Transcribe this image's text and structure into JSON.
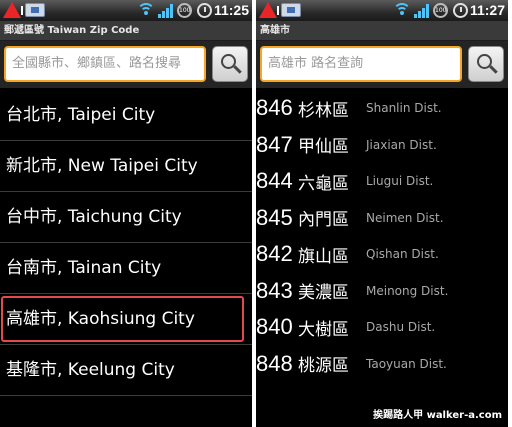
{
  "left": {
    "status": {
      "time": "11:25",
      "battery_label": "100"
    },
    "title": "郵遞區號 Taiwan Zip Code",
    "search": {
      "placeholder": "全國縣市、鄉鎮區、路名搜尋"
    },
    "cities": [
      {
        "label": "台北市, Taipei City"
      },
      {
        "label": "新北市, New Taipei City"
      },
      {
        "label": "台中市, Taichung City"
      },
      {
        "label": "台南市, Tainan City"
      },
      {
        "label": "高雄市, Kaohsiung City",
        "selected": true
      },
      {
        "label": "基隆市, Keelung City"
      }
    ]
  },
  "right": {
    "status": {
      "time": "11:27",
      "battery_label": "100"
    },
    "title": "高雄市",
    "search": {
      "placeholder": "高雄市 路名查詢"
    },
    "districts": [
      {
        "code": "846",
        "name": "杉林區",
        "english": "Shanlin Dist."
      },
      {
        "code": "847",
        "name": "甲仙區",
        "english": "Jiaxian Dist."
      },
      {
        "code": "844",
        "name": "六龜區",
        "english": "Liugui Dist."
      },
      {
        "code": "845",
        "name": "內門區",
        "english": "Neimen Dist."
      },
      {
        "code": "842",
        "name": "旗山區",
        "english": "Qishan Dist."
      },
      {
        "code": "843",
        "name": "美濃區",
        "english": "Meinong Dist."
      },
      {
        "code": "840",
        "name": "大樹區",
        "english": "Dashu Dist."
      },
      {
        "code": "848",
        "name": "桃源區",
        "english": "Taoyuan Dist."
      }
    ]
  },
  "watermark": "挨踢路人甲 walker-a.com",
  "colors": {
    "accent_border": "#f5a623",
    "selected_border": "#e54a4a",
    "background": "#000000"
  }
}
